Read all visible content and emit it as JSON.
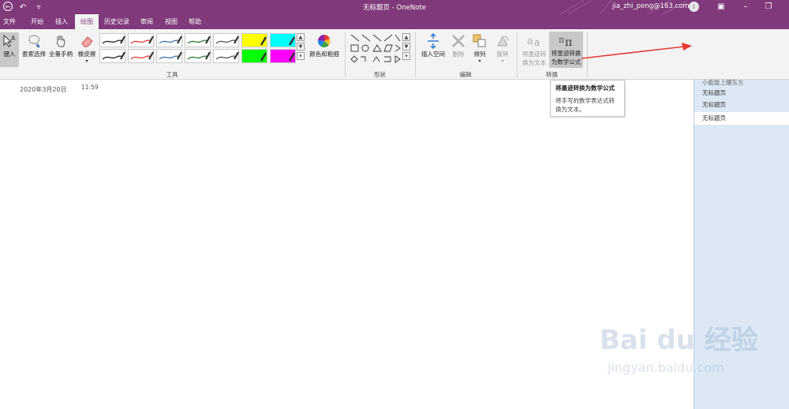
{
  "titlebar": {
    "title": "无标题页 - OneNote",
    "account": "jia_zhi_peng@163.com",
    "avatar_initial": "i"
  },
  "tabs": [
    "文件",
    "开始",
    "插入",
    "绘图",
    "历史记录",
    "审阅",
    "视图",
    "帮助"
  ],
  "active_tab": "绘图",
  "ribbon": {
    "tools": {
      "type_label": "键入",
      "lasso_label": "套索选择",
      "pan_label": "全量手柄",
      "eraser_label": "橡皮擦",
      "color_thickness_label": "颜色和粗细",
      "group_label": "工具"
    },
    "shapes": {
      "group_label": "形状"
    },
    "edit": {
      "insert_space_label": "插入空间",
      "delete_label": "删除",
      "arrange_label": "排列",
      "rotate_label": "旋转",
      "group_label": "编辑"
    },
    "convert": {
      "ink_to_text_label1": "将墨迹转",
      "ink_to_text_label2": "换为文本",
      "ink_to_math_label1": "将墨迹转换",
      "ink_to_math_label2": "为数学公式",
      "group_label": "转换"
    },
    "pen_colors": [
      "#222222",
      "#e53935",
      "#3a6fb0",
      "#2e7d32",
      "#555555",
      "#ffff00",
      "#00ffff",
      "#222222",
      "#e53935",
      "#3a6fb0",
      "#2e7d32",
      "#555555",
      "#00ff00",
      "#ff00ff"
    ]
  },
  "page": {
    "date": "2020年3月20日",
    "time": "11:59"
  },
  "tooltip": {
    "title": "将墨迹转换为数学公式",
    "body_line1": "将手写的数学表达式转",
    "body_line2": "换为文本。"
  },
  "pagelist": {
    "items": [
      {
        "label": "小能能上罐东方"
      },
      {
        "label": "无标题页"
      },
      {
        "label": "无标题页"
      },
      {
        "label": "无标题页"
      }
    ]
  },
  "watermark": {
    "brand": "Bai du 经验",
    "url": "jingyan.baidu.com"
  },
  "colors": {
    "accent": "#80397b",
    "ribbon_bg": "#f3f3f3",
    "pagelist_bg": "#dce9f5",
    "annotation_arrow": "#e53935"
  }
}
